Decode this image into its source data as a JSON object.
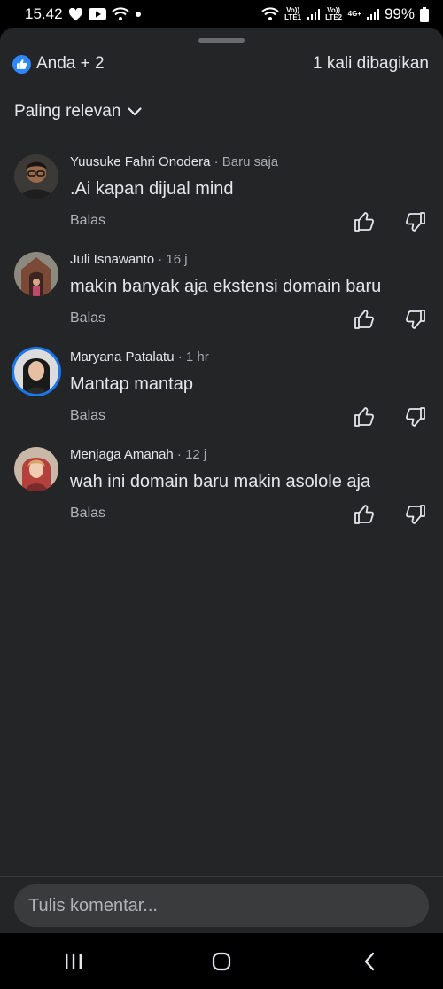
{
  "status_bar": {
    "time": "15.42",
    "sim1": "Vo)) LTE1",
    "sim2": "Vo)) LTE2",
    "net": "4G+",
    "battery": "99%"
  },
  "sheet": {
    "reactions_label": "Anda + 2",
    "shares_label": "1 kali dibagikan",
    "sort_label": "Paling relevan"
  },
  "comments": [
    {
      "name": "Yuusuke Fahri Onodera",
      "time": "· Baru saja",
      "text": ".Ai kapan dijual mind",
      "reply": "Balas"
    },
    {
      "name": "Juli Isnawanto",
      "time": "· 16 j",
      "text": "makin banyak aja ekstensi domain baru",
      "reply": "Balas"
    },
    {
      "name": "Maryana Patalatu",
      "time": "· 1 hr",
      "text": "Mantap mantap",
      "reply": "Balas"
    },
    {
      "name": "Menjaga Amanah",
      "time": "· 12 j",
      "text": "wah ini domain baru makin asolole aja",
      "reply": "Balas"
    }
  ],
  "composer": {
    "placeholder": "Tulis komentar..."
  },
  "icons": {
    "like": "thumbs-up-icon",
    "dislike": "thumbs-down-icon",
    "recent_apps": "recent-apps-icon",
    "home": "home-icon",
    "back": "back-icon"
  },
  "colors": {
    "accent": "#2d88ff",
    "sheet_bg": "#242526"
  }
}
